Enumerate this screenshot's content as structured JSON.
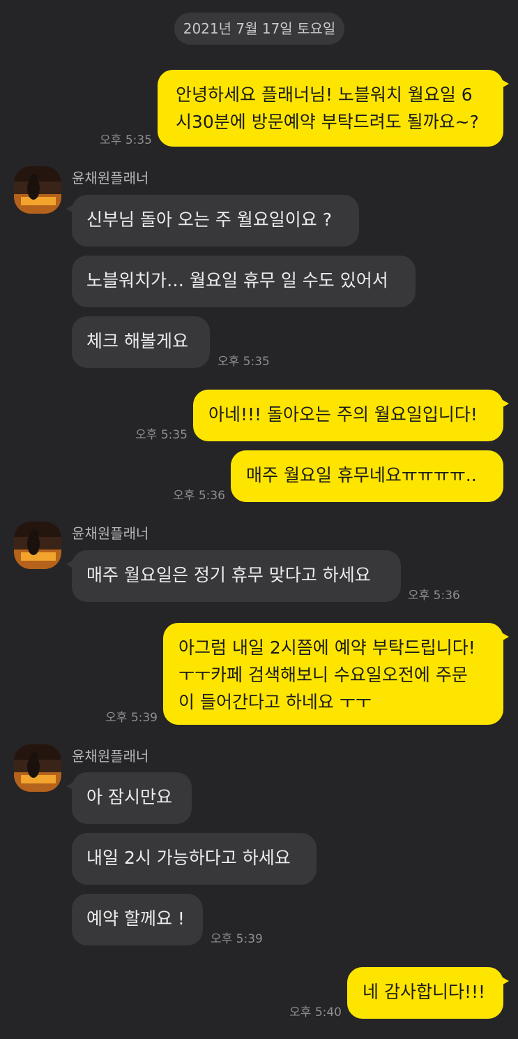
{
  "date_divider": "2021년 7월 17일 토요일",
  "sender_name": "윤채원플래너",
  "avatar_icon": "profile-photo-icon",
  "colors": {
    "background": "#252527",
    "my_bubble": "#fee500",
    "other_bubble": "#38383b"
  },
  "messages": [
    {
      "from": "me",
      "text": "안녕하세요 플래너님! 노블워치 월요일 6\n시30분에 방문예약 부탁드려도 될까요~?",
      "time": "오후 5:35"
    },
    {
      "from": "other",
      "text": "신부님 돌아 오는 주 월요일이요 ?"
    },
    {
      "from": "other",
      "text": "노블워치가… 월요일 휴무 일 수도 있어서"
    },
    {
      "from": "other",
      "text": "체크 해볼게요",
      "time": "오후 5:35"
    },
    {
      "from": "me",
      "text": "아네!!! 돌아오는 주의 월요일입니다!",
      "time": "오후 5:35"
    },
    {
      "from": "me",
      "text": "매주 월요일 휴무네요ㅠㅠㅠㅠ..",
      "time": "오후 5:36"
    },
    {
      "from": "other",
      "text": "매주 월요일은 정기 휴무 맞다고 하세요",
      "time": "오후 5:36"
    },
    {
      "from": "me",
      "text": "아그럼 내일 2시쯤에 예약 부탁드립니다!\nㅜㅜ카페 검색해보니 수요일오전에 주문\n이 들어간다고 하네요 ㅜㅜ",
      "time": "오후 5:39"
    },
    {
      "from": "other",
      "text": "아 잠시만요"
    },
    {
      "from": "other",
      "text": "내일 2시 가능하다고 하세요"
    },
    {
      "from": "other",
      "text": "예약 할께요 !",
      "time": "오후 5:39"
    },
    {
      "from": "me",
      "text": "네 감사합니다!!!",
      "time": "오후 5:40"
    }
  ]
}
